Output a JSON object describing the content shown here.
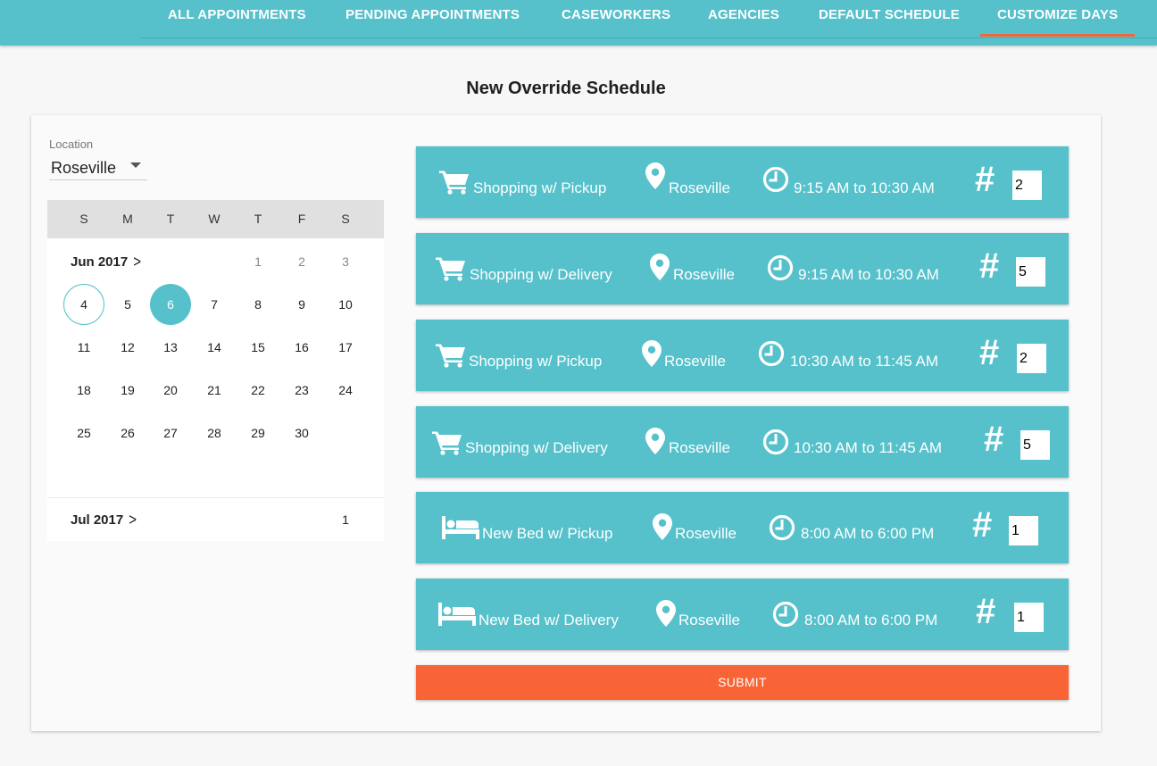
{
  "nav": {
    "tabs": [
      {
        "label": "ALL APPOINTMENTS"
      },
      {
        "label": "PENDING APPOINTMENTS"
      },
      {
        "label": "CASEWORKERS"
      },
      {
        "label": "AGENCIES"
      },
      {
        "label": "DEFAULT SCHEDULE"
      },
      {
        "label": "CUSTOMIZE DAYS"
      }
    ],
    "active_tab": "CUSTOMIZE DAYS"
  },
  "page": {
    "title": "New Override Schedule"
  },
  "location": {
    "label": "Location",
    "value": "Roseville"
  },
  "calendar": {
    "weekdays": [
      "S",
      "M",
      "T",
      "W",
      "T",
      "F",
      "S"
    ],
    "month1": {
      "label": "Jun 2017",
      "chevron": ">",
      "days": [
        "1",
        "2",
        "3",
        "4",
        "5",
        "6",
        "7",
        "8",
        "9",
        "10",
        "11",
        "12",
        "13",
        "14",
        "15",
        "16",
        "17",
        "18",
        "19",
        "20",
        "21",
        "22",
        "23",
        "24",
        "25",
        "26",
        "27",
        "28",
        "29",
        "30"
      ]
    },
    "month2": {
      "label": "Jul 2017",
      "chevron": ">",
      "days": [
        "1"
      ]
    },
    "today": "4",
    "selected": "6"
  },
  "slots": [
    {
      "icon": "cart-icon",
      "service": "Shopping w/ Pickup",
      "location": "Roseville",
      "time": "9:15 AM to 10:30 AM",
      "hash": "#",
      "count": "2"
    },
    {
      "icon": "cart-icon",
      "service": "Shopping w/ Delivery",
      "location": "Roseville",
      "time": "9:15 AM to 10:30 AM",
      "hash": "#",
      "count": "5"
    },
    {
      "icon": "cart-icon",
      "service": "Shopping w/ Pickup",
      "location": "Roseville",
      "time": "10:30 AM to 11:45 AM",
      "hash": "#",
      "count": "2"
    },
    {
      "icon": "cart-icon",
      "service": "Shopping w/ Delivery",
      "location": "Roseville",
      "time": "10:30 AM to 11:45 AM",
      "hash": "#",
      "count": "5"
    },
    {
      "icon": "bed-icon",
      "service": "New Bed w/ Pickup",
      "location": "Roseville",
      "time": "8:00 AM to 6:00 PM",
      "hash": "#",
      "count": "1"
    },
    {
      "icon": "bed-icon",
      "service": "New Bed w/ Delivery",
      "location": "Roseville",
      "time": "8:00 AM to 6:00 PM",
      "hash": "#",
      "count": "1"
    }
  ],
  "submit": {
    "label": "SUBMIT"
  },
  "colors": {
    "primary": "#56c1cb",
    "accent": "#f86436",
    "tab_indicator": "#f2663a",
    "calendar_header": "#e0e0e0"
  }
}
